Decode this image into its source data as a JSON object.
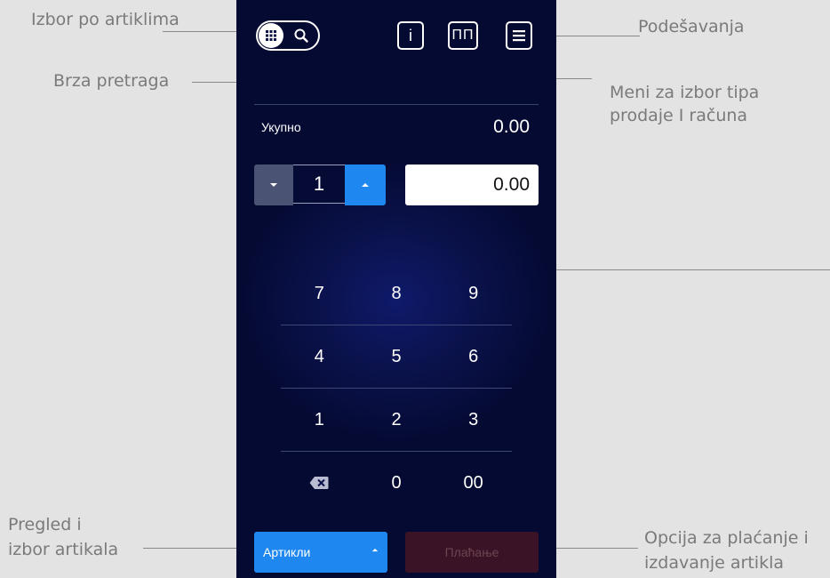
{
  "callouts": {
    "izbor_po_artiklima": "Izbor po artiklima",
    "brza_pretraga": "Brza pretraga",
    "podesavanja": "Podešavanja",
    "meni_line1": "Meni za izbor tipa",
    "meni_line2": "prodaje I računa",
    "pregled_line1": "Pregled i",
    "pregled_line2": "izbor artikala",
    "opcija_line1": "Opcija za plaćanje i",
    "opcija_line2": "izdavanje artikla"
  },
  "toolbar": {
    "info_label": "i",
    "sale_type_label": "ПП"
  },
  "total": {
    "label": "Укупно",
    "value": "0.00"
  },
  "quantity": {
    "value": "1"
  },
  "price": {
    "value": "0.00"
  },
  "keypad": {
    "rows": [
      [
        "7",
        "8",
        "9"
      ],
      [
        "4",
        "5",
        "6"
      ],
      [
        "1",
        "2",
        "3"
      ],
      [
        "",
        "0",
        "00"
      ]
    ]
  },
  "bottom": {
    "articles_label": "Артикли",
    "pay_label": "Плаћање"
  },
  "colors": {
    "accent": "#1e88f0",
    "background": "#050a33",
    "pay_disabled": "#3a1426"
  },
  "icons": {
    "toggle_left": "keypad-grid-icon",
    "toggle_right": "search-icon",
    "menu": "hamburger-icon",
    "backspace": "backspace-icon"
  }
}
